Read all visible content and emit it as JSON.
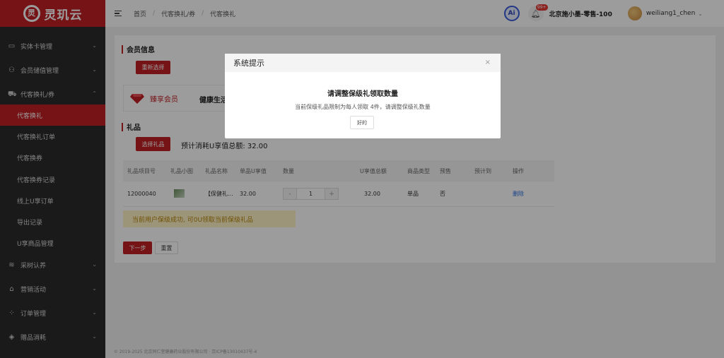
{
  "sidebar": {
    "logo_mark": "灵",
    "logo_text": "灵玑云",
    "groups_top": [
      {
        "label": "实体卡管理",
        "icon": "card-icon"
      },
      {
        "label": "会员储值管理",
        "icon": "users-icon"
      }
    ],
    "active_group": {
      "label": "代客换礼/券",
      "icon": "cart-icon"
    },
    "sub_items": [
      {
        "label": "代客换礼"
      },
      {
        "label": "代客换礼订单"
      },
      {
        "label": "代客换券"
      },
      {
        "label": "代客换券记录"
      },
      {
        "label": "线上U享订单"
      },
      {
        "label": "导出记录"
      },
      {
        "label": "U享商品管理"
      }
    ],
    "groups_bottom": [
      {
        "label": "采树认养",
        "icon": "wifi-icon"
      },
      {
        "label": "营销活动",
        "icon": "gift-icon"
      },
      {
        "label": "订单管理",
        "icon": "grid-icon"
      },
      {
        "label": "赠品消耗",
        "icon": "box-icon"
      }
    ]
  },
  "header": {
    "breadcrumbs": [
      "首页",
      "代客换礼/券",
      "代客换礼"
    ],
    "ai_label": "Ai",
    "bell_badge": "99+",
    "store_name": "北京施小墨-零售-100",
    "username": "weiliang1_chen"
  },
  "main": {
    "member_section_title": "会员信息",
    "reselect_button": "重新选择",
    "member_level": "臻享会员",
    "member_desc": "健康生活",
    "gift_section_title": "礼品",
    "select_gift_button": "选择礼品",
    "total_label": "预计消耗U享值总额: 32.00",
    "table": {
      "headers": [
        "礼品项目号",
        "礼品小图",
        "礼品名称",
        "单品U享值",
        "数量",
        "U享值总额",
        "商品类型",
        "预售",
        "预计到",
        "操作"
      ],
      "rows": [
        {
          "id": "12000040",
          "name": "【保健礼...",
          "unit": "32.00",
          "qty": "1",
          "total": "32.00",
          "type": "单品",
          "presale": "否",
          "eta": "",
          "action": "删除"
        }
      ],
      "minus": "-",
      "plus": "+"
    },
    "notice": "当前用户保级成功, 可0U领取当前保级礼品",
    "next_button": "下一步",
    "reset_button": "重置"
  },
  "footer": "© 2019-2025 北京同仁堂健康药业股份有限公司 · 京ICP备13010437号-4",
  "modal": {
    "title": "系统提示",
    "close": "×",
    "heading": "请调整保级礼领取数量",
    "message": "当前保级礼品限制为每人领取 4件，请调整保级礼数量",
    "ok_button": "好的"
  }
}
